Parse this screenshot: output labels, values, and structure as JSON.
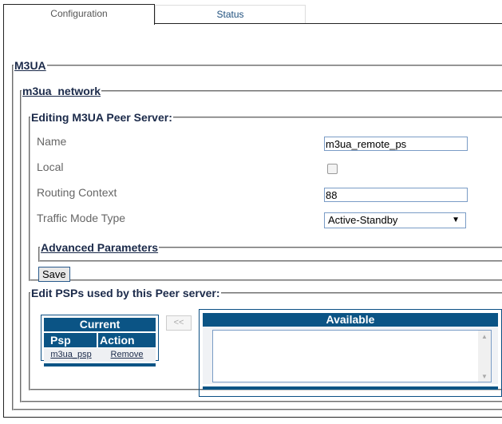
{
  "tabs": [
    {
      "label": "Configuration",
      "active": true
    },
    {
      "label": "Status",
      "active": false
    }
  ],
  "sections": {
    "m3ua": "M3UA",
    "network": "m3ua_network",
    "editing": "Editing M3UA Peer Server:",
    "advanced": "Advanced Parameters",
    "psps": "Edit PSPs used by this Peer server:"
  },
  "form": {
    "name_label": "Name",
    "name_value": "m3ua_remote_ps",
    "local_label": "Local",
    "local_checked": false,
    "routing_label": "Routing Context",
    "routing_value": "88",
    "traffic_label": "Traffic Mode Type",
    "traffic_value": "Active-Standby",
    "save_label": "Save"
  },
  "current": {
    "title": "Current",
    "columns": [
      "Psp",
      "Action"
    ],
    "rows": [
      {
        "psp": "m3ua_psp",
        "action": "Remove"
      }
    ]
  },
  "move_label": "<<",
  "available": {
    "title": "Available",
    "items": []
  },
  "colors": {
    "header_bg": "#0b5485",
    "link": "#1b2a4a"
  }
}
